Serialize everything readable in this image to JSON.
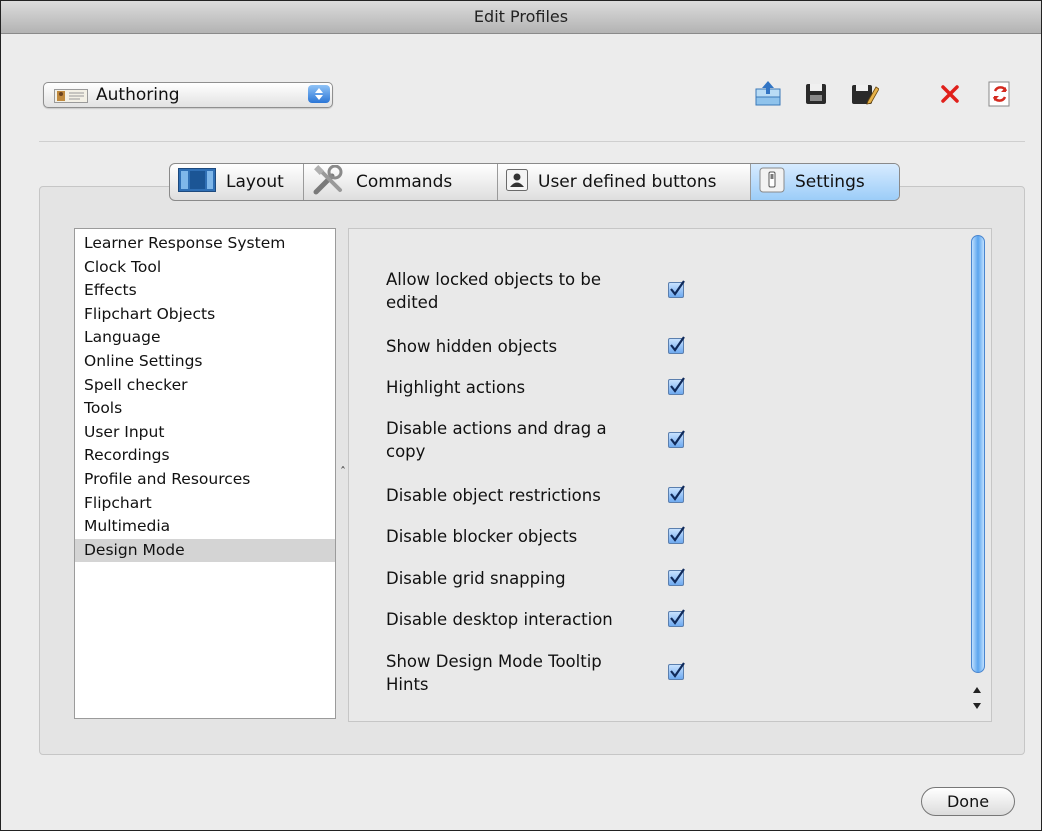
{
  "window": {
    "title": "Edit Profiles"
  },
  "profile": {
    "selected": "Authoring"
  },
  "toolbar": {
    "icons": [
      "export-profile-icon",
      "save-icon",
      "save-as-icon",
      "delete-icon",
      "refresh-icon"
    ],
    "delete_color": "#e0201b",
    "refresh_color": "#d42a1f"
  },
  "tabs": [
    {
      "label": "Layout",
      "icon": "layout-icon"
    },
    {
      "label": "Commands",
      "icon": "tools-icon"
    },
    {
      "label": "User defined buttons",
      "icon": "user-icon"
    },
    {
      "label": "Settings",
      "icon": "settings-icon",
      "active": true
    }
  ],
  "categories": [
    "Learner Response System",
    "Clock Tool",
    "Effects",
    "Flipchart Objects",
    "Language",
    "Online Settings",
    "Spell checker",
    "Tools",
    "User Input",
    "Recordings",
    "Profile and Resources",
    "Flipchart",
    "Multimedia",
    "Design Mode"
  ],
  "selected_category": "Design Mode",
  "options": [
    {
      "label": "Allow locked objects to be edited",
      "checked": true
    },
    {
      "label": "Show hidden objects",
      "checked": true
    },
    {
      "label": "Highlight actions",
      "checked": true
    },
    {
      "label": "Disable actions and drag a copy",
      "checked": true
    },
    {
      "label": "Disable object restrictions",
      "checked": true
    },
    {
      "label": "Disable blocker objects",
      "checked": true
    },
    {
      "label": "Disable grid snapping",
      "checked": true
    },
    {
      "label": "Disable desktop interaction",
      "checked": true
    },
    {
      "label": "Show Design Mode Tooltip Hints",
      "checked": true
    }
  ],
  "buttons": {
    "done": "Done"
  },
  "colors": {
    "accent": "#3b87e3",
    "selection": "#d4d4d4"
  }
}
